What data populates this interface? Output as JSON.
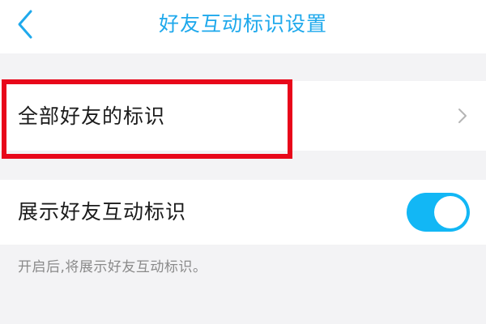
{
  "header": {
    "title": "好友互动标识设置",
    "back_icon": "chevron-left-icon",
    "accent_color": "#1fa9ec"
  },
  "rows": {
    "all_friends": {
      "label": "全部好友的标识",
      "chevron_icon": "chevron-right-icon"
    },
    "show_interaction": {
      "label": "展示好友互动标识",
      "toggle_on": true,
      "toggle_color": "#12b7f5"
    }
  },
  "hint": "开启后,将展示好友互动标识。",
  "annotation": {
    "highlight_color": "#e8071a"
  }
}
